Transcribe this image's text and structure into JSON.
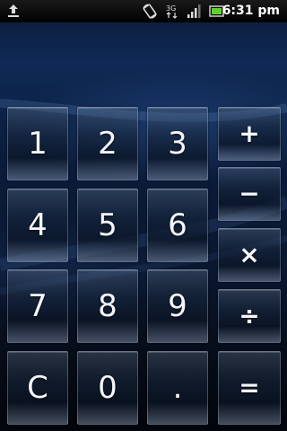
{
  "status_bar": {
    "time": "6:31 pm",
    "network_label": "3G",
    "icons": [
      "upload-icon",
      "rotate-icon",
      "3g-network-icon",
      "signal-strength-icon",
      "battery-icon"
    ]
  },
  "keypad": {
    "digits": {
      "one": "1",
      "two": "2",
      "three": "3",
      "four": "4",
      "five": "5",
      "six": "6",
      "seven": "7",
      "eight": "8",
      "nine": "9",
      "zero": "0"
    },
    "clear": "C",
    "decimal": ".",
    "operators": {
      "plus": "+",
      "minus": "−",
      "multiply": "×",
      "divide": "÷",
      "equals": "="
    }
  },
  "colors": {
    "status_bar_bg": "#000000",
    "background_top": "#0f2a55",
    "background_bottom": "#02050b",
    "key_text": "#ffffff",
    "battery_green": "#5fd02a"
  }
}
